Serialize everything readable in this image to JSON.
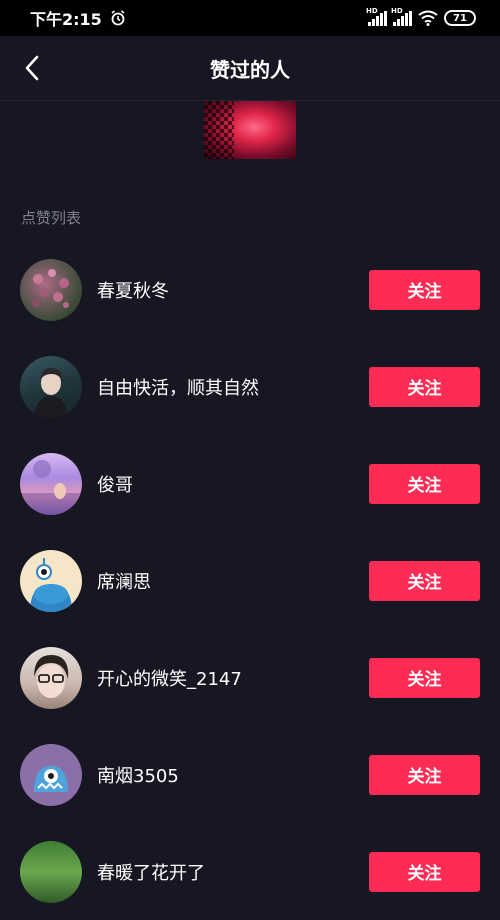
{
  "status_bar": {
    "time": "下午2:15",
    "signal_label_1": "HD",
    "signal_label_2": "HD",
    "battery": "71"
  },
  "header": {
    "title": "赞过的人",
    "back_icon": "chevron-left-icon"
  },
  "section": {
    "title": "点赞列表"
  },
  "users": [
    {
      "name": "春夏秋冬",
      "button": "关注"
    },
    {
      "name": "自由快活，顺其自然",
      "button": "关注"
    },
    {
      "name": "俊哥",
      "button": "关注"
    },
    {
      "name": "席澜思",
      "button": "关注"
    },
    {
      "name": "开心的微笑_2147",
      "button": "关注"
    },
    {
      "name": "南烟3505",
      "button": "关注"
    },
    {
      "name": "春暖了花开了",
      "button": "关注"
    }
  ],
  "colors": {
    "background": "#161722",
    "follow_button": "#fe2c55",
    "muted_text": "#80818a"
  }
}
